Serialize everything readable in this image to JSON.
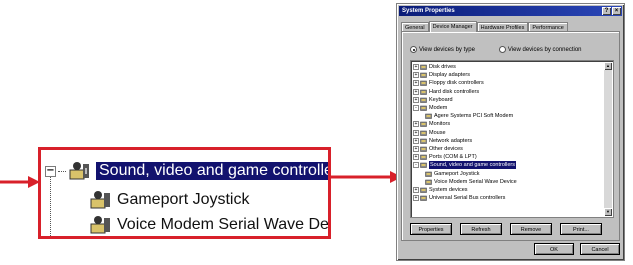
{
  "zoom": {
    "selected_label": "Sound, video and game controllers",
    "children": [
      "Gameport Joystick",
      "Voice Modem Serial Wave Dev"
    ]
  },
  "dialog": {
    "title": "System Properties",
    "title_buttons": [
      "?",
      "×"
    ],
    "tabs": [
      "General",
      "Device Manager",
      "Hardware Profiles",
      "Performance"
    ],
    "active_tab": "Device Manager",
    "view_by_type": "View devices by type",
    "view_by_connection": "View devices by connection",
    "tree": [
      {
        "label": "Disk drives",
        "expander": "+",
        "child": false,
        "selected": false
      },
      {
        "label": "Display adapters",
        "expander": "+",
        "child": false,
        "selected": false
      },
      {
        "label": "Floppy disk controllers",
        "expander": "+",
        "child": false,
        "selected": false
      },
      {
        "label": "Hard disk controllers",
        "expander": "+",
        "child": false,
        "selected": false
      },
      {
        "label": "Keyboard",
        "expander": "+",
        "child": false,
        "selected": false
      },
      {
        "label": "Modem",
        "expander": "-",
        "child": false,
        "selected": false
      },
      {
        "label": "Agere Systems PCI Soft Modem",
        "expander": "",
        "child": true,
        "selected": false
      },
      {
        "label": "Monitors",
        "expander": "+",
        "child": false,
        "selected": false
      },
      {
        "label": "Mouse",
        "expander": "+",
        "child": false,
        "selected": false
      },
      {
        "label": "Network adapters",
        "expander": "+",
        "child": false,
        "selected": false
      },
      {
        "label": "Other devices",
        "expander": "+",
        "child": false,
        "selected": false
      },
      {
        "label": "Ports (COM & LPT)",
        "expander": "+",
        "child": false,
        "selected": false
      },
      {
        "label": "Sound, video and game controllers",
        "expander": "-",
        "child": false,
        "selected": true
      },
      {
        "label": "Gameport Joystick",
        "expander": "",
        "child": true,
        "selected": false
      },
      {
        "label": "Voice Modem Serial Wave Device",
        "expander": "",
        "child": true,
        "selected": false
      },
      {
        "label": "System devices",
        "expander": "+",
        "child": false,
        "selected": false
      },
      {
        "label": "Universal Serial Bus controllers",
        "expander": "+",
        "child": false,
        "selected": false
      }
    ],
    "buttons": [
      "Properties",
      "Refresh",
      "Remove",
      "Print..."
    ],
    "ok_label": "OK",
    "cancel_label": "Cancel"
  },
  "colors": {
    "highlight": "#12126e",
    "callout_red": "#d8202a",
    "titlebar": "#0a1c78"
  }
}
